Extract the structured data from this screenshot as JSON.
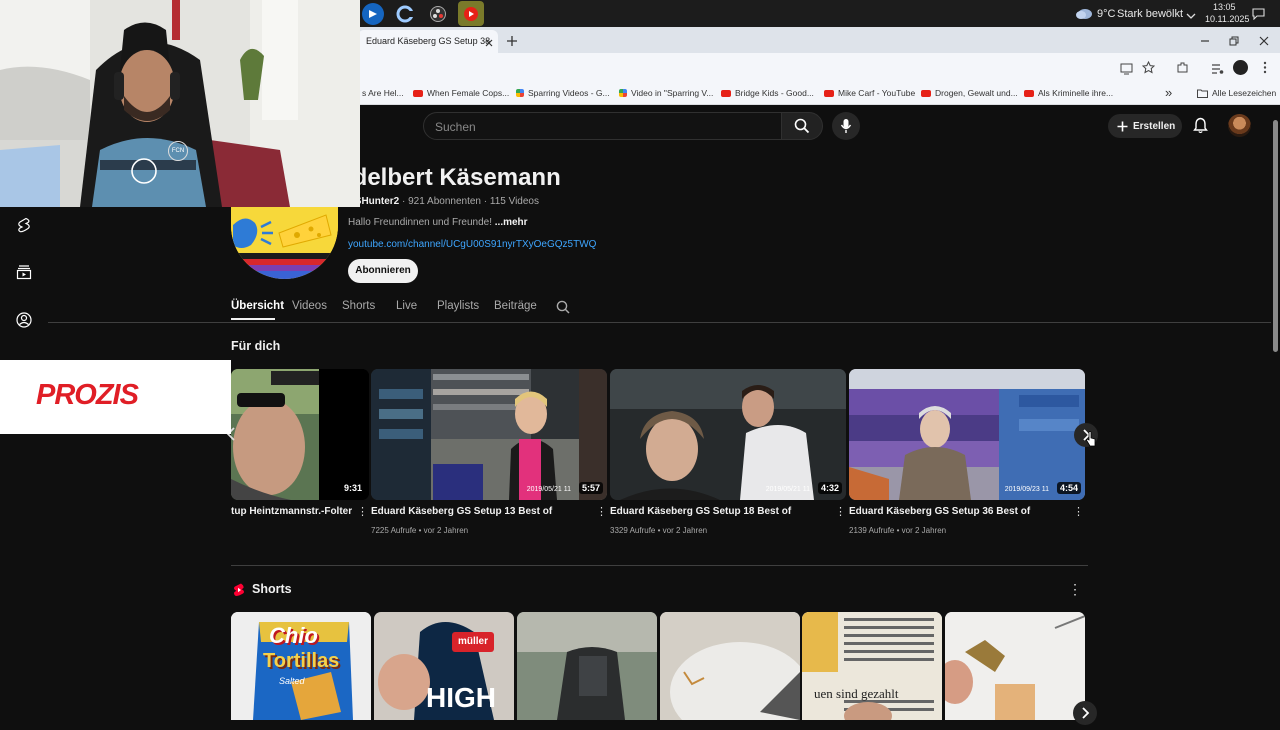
{
  "taskbar": {
    "weather_temp": "9°C",
    "weather_text": "Stark bewölkt",
    "time": "13:05",
    "date": "10.11.2025"
  },
  "browser": {
    "tab_title": "Eduard Käseberg GS Setup 38",
    "bookmarks": [
      {
        "label": "s Are Hel...",
        "icon": "none"
      },
      {
        "label": "When Female Cops...",
        "icon": "youtube"
      },
      {
        "label": "Sparring Videos - G...",
        "icon": "google-drive"
      },
      {
        "label": "Video in \"Sparring V...",
        "icon": "google-drive"
      },
      {
        "label": "Bridge Kids - Good...",
        "icon": "youtube"
      },
      {
        "label": "Mike Carf - YouTube",
        "icon": "youtube"
      },
      {
        "label": "Drogen, Gewalt und...",
        "icon": "youtube"
      },
      {
        "label": "Als Kriminelle ihre...",
        "icon": "youtube"
      }
    ],
    "bookmarks_more": "»",
    "all_bookmarks": "Alle Lesezeichen"
  },
  "header": {
    "search_placeholder": "Suchen",
    "create_label": "Erstellen"
  },
  "channel": {
    "name": "idelbert Käsemann",
    "handle": "GSHunter2",
    "subscribers": "921 Abonnenten",
    "videos_count": "115 Videos",
    "description": "Hallo Freundinnen und Freunde!",
    "more": "...mehr",
    "link": "youtube.com/channel/UCgU00S91nyrTXyOeGQz5TWQ",
    "subscribe_label": "Abonnieren"
  },
  "tabs": [
    "Übersicht",
    "Videos",
    "Shorts",
    "Live",
    "Playlists",
    "Beiträge"
  ],
  "section_for_you": "Für dich",
  "videos": [
    {
      "title": "tup Heintzmannstr.-Folter",
      "views": "",
      "age": "",
      "duration": "9:31",
      "stamp": ""
    },
    {
      "title": "Eduard Käseberg GS Setup 13 Best of",
      "views": "7225 Aufrufe",
      "age": "vor 2 Jahren",
      "duration": "5:57",
      "stamp": "2019/05/21  11"
    },
    {
      "title": "Eduard Käseberg GS Setup 18 Best of",
      "views": "3329 Aufrufe",
      "age": "vor 2 Jahren",
      "duration": "4:32",
      "stamp": "2019/05/21  11"
    },
    {
      "title": "Eduard Käseberg GS Setup 36 Best of",
      "views": "2139 Aufrufe",
      "age": "vor 2 Jahren",
      "duration": "4:54",
      "stamp": "2019/09/23  11"
    }
  ],
  "section_shorts": "Shorts",
  "shorts_text": {
    "chio": "Chio",
    "tortillas": "Tortillas",
    "salted": "Salted",
    "muller": "müller",
    "high": "HIGH",
    "newspaper": "uen sind gezahlt"
  },
  "overlay": {
    "sponsor": "PROZIS",
    "webcam_badge": "FCN"
  },
  "colors": {
    "accent_red": "#ff0000",
    "link_blue": "#3ea6ff",
    "sponsor_red": "#e01e26"
  }
}
